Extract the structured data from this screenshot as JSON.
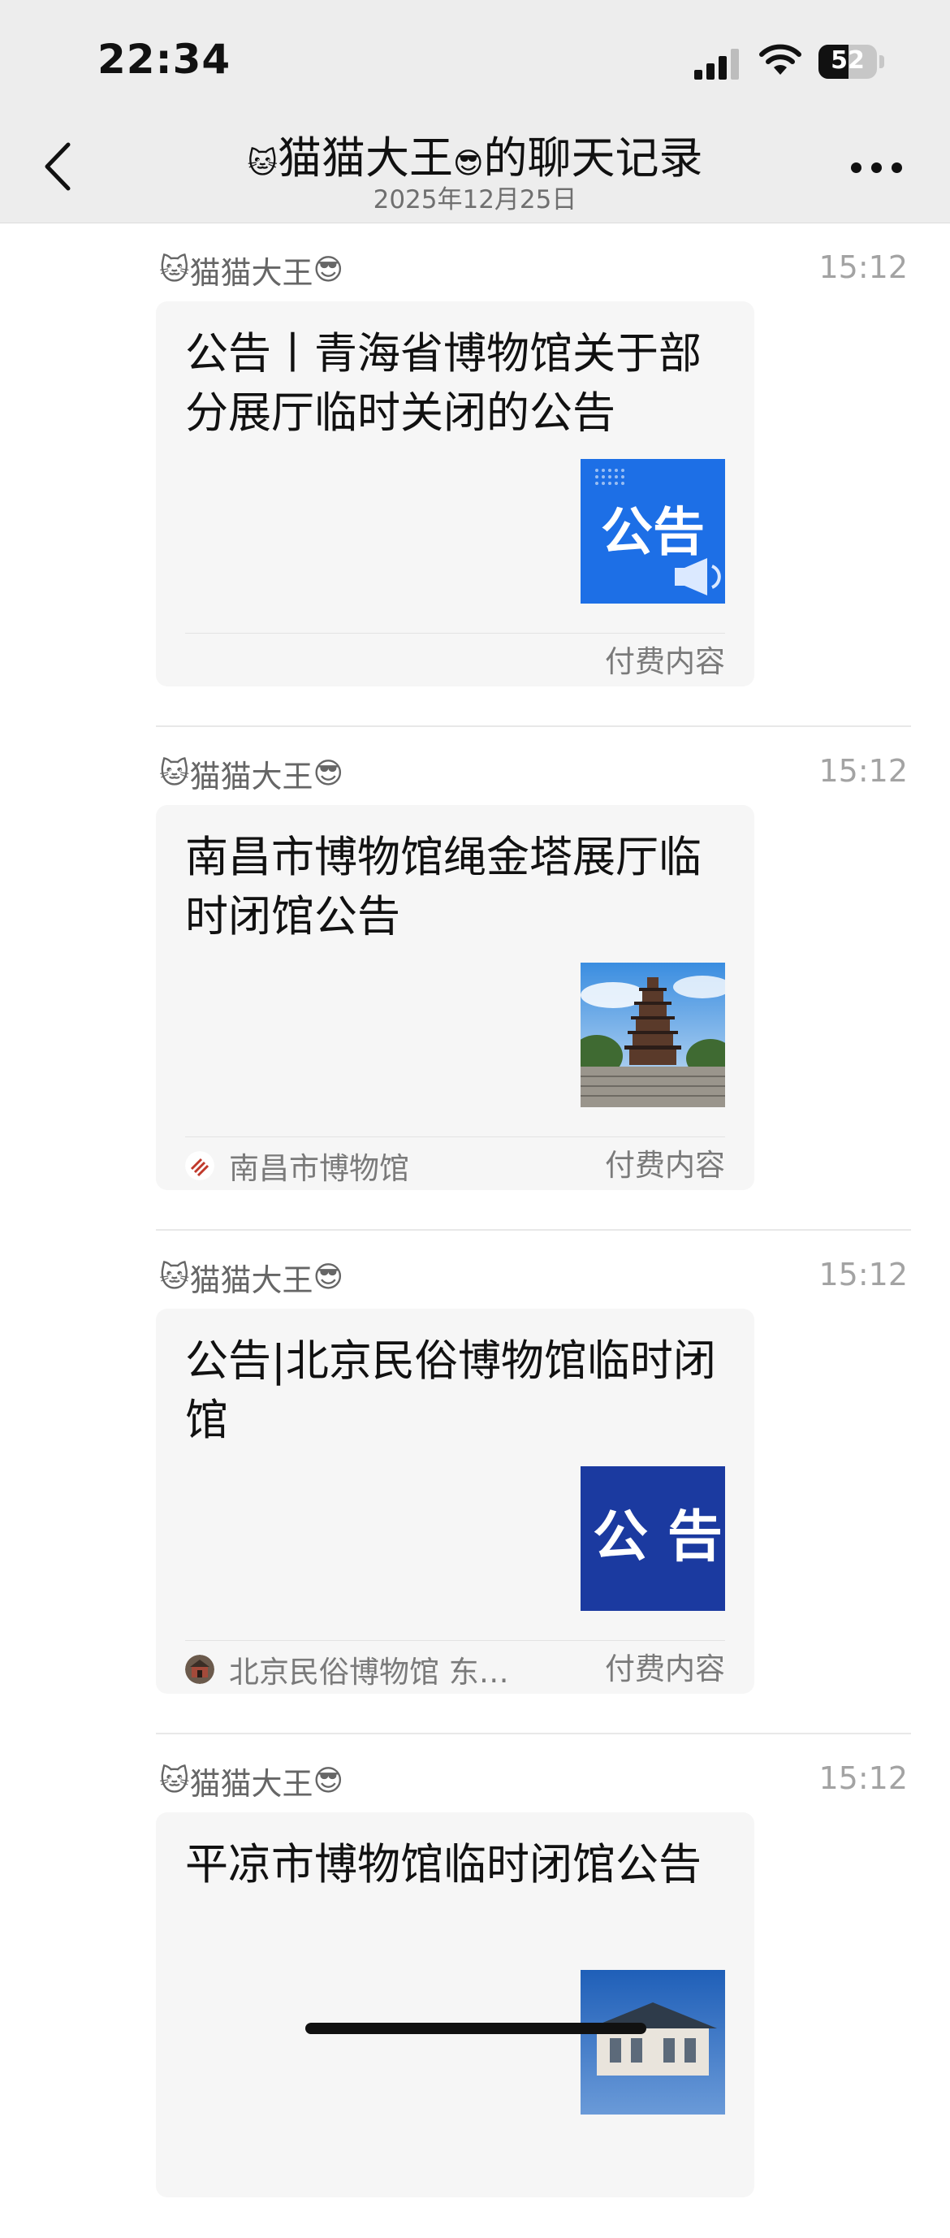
{
  "status_bar": {
    "time": "22:34",
    "battery": "52",
    "battery_level": 0.52
  },
  "nav": {
    "title_left_emoji": "🐱",
    "title_name": "猫猫大王",
    "title_right_emoji": "😎",
    "title_suffix": "的聊天记录",
    "subtitle": "2025年12月25日"
  },
  "colors": {
    "background": "#ffffff",
    "header": "#ededed",
    "card": "#f6f6f6",
    "text_secondary": "#7a7a7a",
    "time": "#a3a3a3"
  },
  "messages": [
    {
      "sender_emoji_left": "🐱",
      "sender": "猫猫大王",
      "sender_emoji_right": "😎",
      "time": "15:12",
      "title": "公告丨青海省博物馆关于部分展厅临时关闭的公告",
      "thumb_text": "公告",
      "thumb_icon": "megaphone-icon",
      "source": "",
      "paid": "付费内容"
    },
    {
      "sender_emoji_left": "🐱",
      "sender": "猫猫大王",
      "sender_emoji_right": "😎",
      "time": "15:12",
      "title": "南昌市博物馆绳金塔展厅临时闭馆公告",
      "thumb_text": "",
      "thumb_icon": "pagoda-photo",
      "source": "南昌市博物馆",
      "paid": "付费内容"
    },
    {
      "sender_emoji_left": "🐱",
      "sender": "猫猫大王",
      "sender_emoji_right": "😎",
      "time": "15:12",
      "title": "公告|北京民俗博物馆临时闭馆",
      "thumb_text": "公 告",
      "thumb_icon": "notice-banner",
      "source": "北京民俗博物馆 东…",
      "paid": "付费内容"
    },
    {
      "sender_emoji_left": "🐱",
      "sender": "猫猫大王",
      "sender_emoji_right": "😎",
      "time": "15:12",
      "title": "平凉市博物馆临时闭馆公告",
      "thumb_text": "",
      "thumb_icon": "building-photo",
      "source": "",
      "paid": ""
    }
  ]
}
